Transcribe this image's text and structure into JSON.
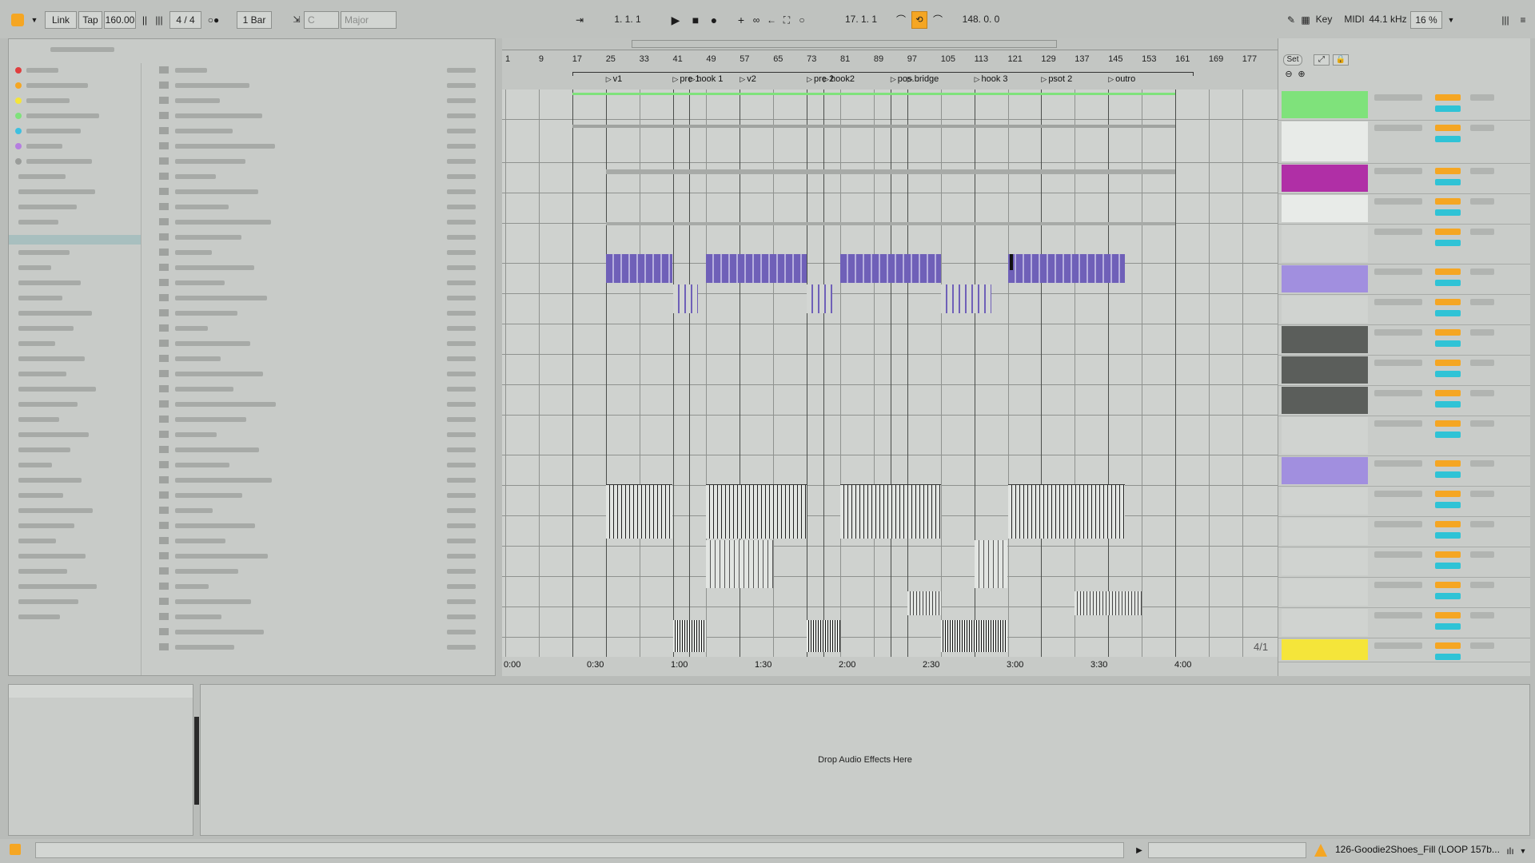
{
  "transport": {
    "link": "Link",
    "tap": "Tap",
    "tempo": "160.00",
    "time_signature": "4 / 4",
    "quantize": "1 Bar",
    "key_root": "C",
    "scale": "Major",
    "position": "1.  1.  1",
    "loop_start": "17.  1.  1",
    "loop_length": "148.  0.  0",
    "key_button": "Key",
    "midi_button": "MIDI",
    "sample_rate": "44.1 kHz",
    "cpu": "16 %"
  },
  "arrangement": {
    "bar_numbers": [
      "1",
      "9",
      "17",
      "25",
      "33",
      "41",
      "49",
      "57",
      "65",
      "73",
      "81",
      "89",
      "97",
      "105",
      "113",
      "121",
      "129",
      "137",
      "145",
      "153",
      "161",
      "169",
      "177"
    ],
    "locators": [
      "v1",
      "pre 1",
      "hook 1",
      "v2",
      "pre 2",
      "hook2",
      "pos...",
      "bridge",
      "hook 3",
      "psot 2",
      "outro"
    ],
    "time_labels": [
      "0:00",
      "0:30",
      "1:00",
      "1:30",
      "2:00",
      "2:30",
      "3:00",
      "3:30",
      "4:00"
    ],
    "zoom_indicator": "4/1",
    "set_button": "Set"
  },
  "device_panel": {
    "drop_text": "Drop Audio Effects Here"
  },
  "status": {
    "clip_name": "126-Goodie2Shoes_Fill (LOOP 157b..."
  },
  "colors": {
    "accent": "#f5a623",
    "green": "#7fe27b",
    "purple": "#b02fa6",
    "lavender": "#a18fdf",
    "yellow": "#f5e53a",
    "cyan": "#2fc3d6",
    "clip_blue": "#6f60b8"
  }
}
